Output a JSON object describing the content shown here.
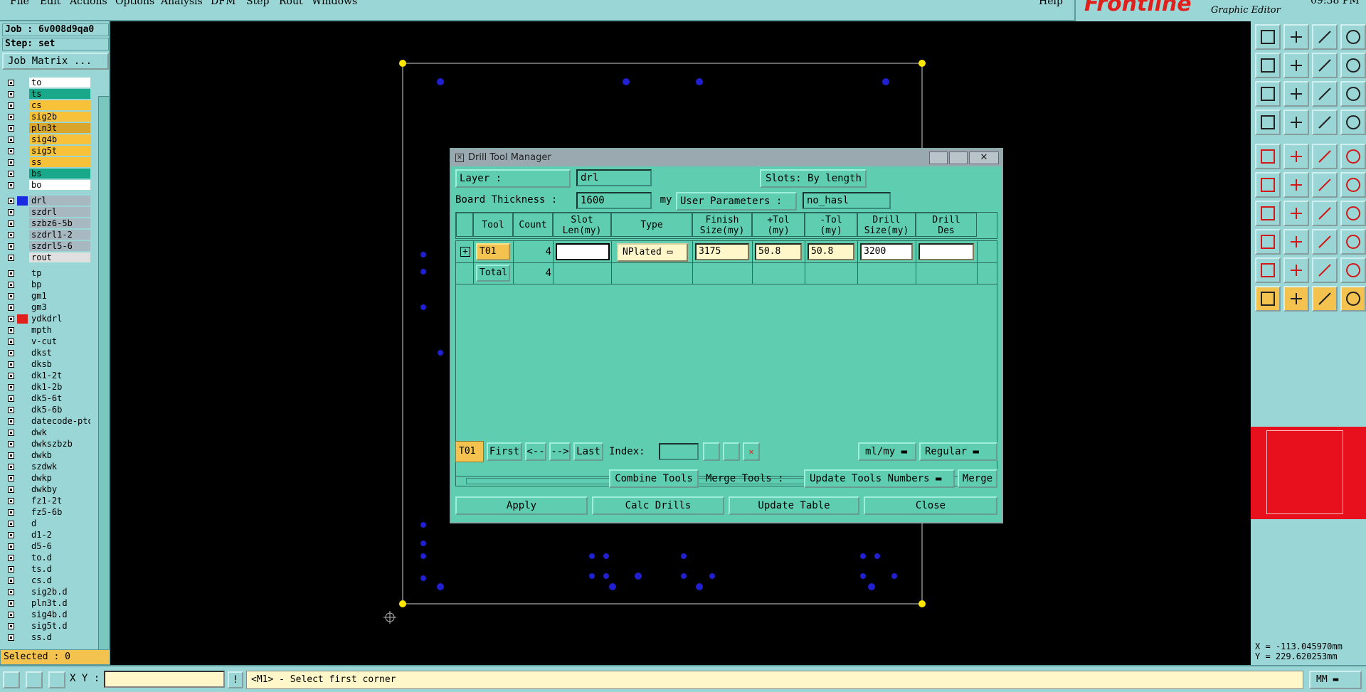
{
  "menu": {
    "items": [
      "File",
      "Edit",
      "Actions",
      "Options",
      "Analysis",
      "DFM",
      "Step",
      "Rout",
      "Windows"
    ],
    "help": "Help"
  },
  "brand": {
    "logo": "Frontline",
    "subtitle": "Graphic Editor",
    "clock": "09:38 PM"
  },
  "job": {
    "job_line": "Job : 6v008d9qa0",
    "step_line": "Step: set",
    "matrix_button": "Job Matrix ..."
  },
  "layers": [
    {
      "name": "to",
      "color": "#ffffff",
      "swatch": ""
    },
    {
      "name": "ts",
      "color": "#1aa88a",
      "swatch": ""
    },
    {
      "name": "cs",
      "color": "#f7c23a",
      "swatch": ""
    },
    {
      "name": "sig2b",
      "color": "#f7c23a",
      "swatch": ""
    },
    {
      "name": "pln3t",
      "color": "#d9a52a",
      "swatch": ""
    },
    {
      "name": "sig4b",
      "color": "#f7c23a",
      "swatch": ""
    },
    {
      "name": "sig5t",
      "color": "#f7c23a",
      "swatch": ""
    },
    {
      "name": "ss",
      "color": "#f7c23a",
      "swatch": ""
    },
    {
      "name": "bs",
      "color": "#1aa88a",
      "swatch": ""
    },
    {
      "name": "bo",
      "color": "#ffffff",
      "swatch": ""
    },
    {
      "name": "drl",
      "color": "#a8b8c0",
      "swatch": "#1a2ae0"
    },
    {
      "name": "szdrl",
      "color": "#a8b8c0",
      "swatch": ""
    },
    {
      "name": "szbz6-5b",
      "color": "#a8b8c0",
      "swatch": ""
    },
    {
      "name": "szdrl1-2",
      "color": "#a8b8c0",
      "swatch": ""
    },
    {
      "name": "szdrl5-6",
      "color": "#a8b8c0",
      "swatch": ""
    },
    {
      "name": "rout",
      "color": "#e0e0e0",
      "swatch": ""
    },
    {
      "name": "tp",
      "color": "#9bd6d6",
      "swatch": ""
    },
    {
      "name": "bp",
      "color": "#9bd6d6",
      "swatch": ""
    },
    {
      "name": "gm1",
      "color": "#9bd6d6",
      "swatch": ""
    },
    {
      "name": "gm3",
      "color": "#9bd6d6",
      "swatch": ""
    },
    {
      "name": "ydkdrl",
      "color": "#9bd6d6",
      "swatch": "#e0201c"
    },
    {
      "name": "mpth",
      "color": "#9bd6d6",
      "swatch": ""
    },
    {
      "name": "v-cut",
      "color": "#9bd6d6",
      "swatch": ""
    },
    {
      "name": "dkst",
      "color": "#9bd6d6",
      "swatch": ""
    },
    {
      "name": "dksb",
      "color": "#9bd6d6",
      "swatch": ""
    },
    {
      "name": "dk1-2t",
      "color": "#9bd6d6",
      "swatch": ""
    },
    {
      "name": "dk1-2b",
      "color": "#9bd6d6",
      "swatch": ""
    },
    {
      "name": "dk5-6t",
      "color": "#9bd6d6",
      "swatch": ""
    },
    {
      "name": "dk5-6b",
      "color": "#9bd6d6",
      "swatch": ""
    },
    {
      "name": "datecode-pto",
      "color": "#9bd6d6",
      "swatch": ""
    },
    {
      "name": "dwk",
      "color": "#9bd6d6",
      "swatch": ""
    },
    {
      "name": "dwkszbzb",
      "color": "#9bd6d6",
      "swatch": ""
    },
    {
      "name": "dwkb",
      "color": "#9bd6d6",
      "swatch": ""
    },
    {
      "name": "szdwk",
      "color": "#9bd6d6",
      "swatch": ""
    },
    {
      "name": "dwkp",
      "color": "#9bd6d6",
      "swatch": ""
    },
    {
      "name": "dwkby",
      "color": "#9bd6d6",
      "swatch": ""
    },
    {
      "name": "fz1-2t",
      "color": "#9bd6d6",
      "swatch": ""
    },
    {
      "name": "fz5-6b",
      "color": "#9bd6d6",
      "swatch": ""
    },
    {
      "name": "d",
      "color": "#9bd6d6",
      "swatch": ""
    },
    {
      "name": "d1-2",
      "color": "#9bd6d6",
      "swatch": ""
    },
    {
      "name": "d5-6",
      "color": "#9bd6d6",
      "swatch": ""
    },
    {
      "name": "to.d",
      "color": "#9bd6d6",
      "swatch": ""
    },
    {
      "name": "ts.d",
      "color": "#9bd6d6",
      "swatch": ""
    },
    {
      "name": "cs.d",
      "color": "#9bd6d6",
      "swatch": ""
    },
    {
      "name": "sig2b.d",
      "color": "#9bd6d6",
      "swatch": ""
    },
    {
      "name": "pln3t.d",
      "color": "#9bd6d6",
      "swatch": ""
    },
    {
      "name": "sig4b.d",
      "color": "#9bd6d6",
      "swatch": ""
    },
    {
      "name": "sig5t.d",
      "color": "#9bd6d6",
      "swatch": ""
    },
    {
      "name": "ss.d",
      "color": "#9bd6d6",
      "swatch": ""
    }
  ],
  "selected": "Selected : 0",
  "dialog": {
    "title": "Drill Tool Manager",
    "layer_label": "Layer          :",
    "layer_value": "drl",
    "slots_label": "Slots:",
    "slots_value": "By length",
    "board_thickness_label": "Board Thickness :",
    "board_thickness_value": "1600",
    "thickness_unit": "my",
    "user_params_label": "User Parameters :",
    "user_params_value": "no_hasl",
    "headers": [
      "Tool",
      "Count",
      "Slot\nLen(my)",
      "Type",
      "Finish\nSize(my)",
      "+Tol\n(my)",
      "-Tol\n(my)",
      "Drill\nSize(my)",
      "Drill\nDes"
    ],
    "row": {
      "tool": "T01",
      "count": "4",
      "slot_len": "",
      "type": "NPlated",
      "finish": "3175",
      "ptol": "50.8",
      "ntol": "50.8",
      "drill": "3200",
      "des": ""
    },
    "total": {
      "label": "Total",
      "count": "4"
    },
    "nav": {
      "current": "T01",
      "first": "First",
      "prev": "<--",
      "next": "-->",
      "last": "Last",
      "index_label": "Index:",
      "index_value": "",
      "units": "ml/my",
      "mode": "Regular"
    },
    "combine": "Combine Tools",
    "merge_tools_label": "Merge Tools :",
    "update_numbers": "Update Tools Numbers",
    "merge": "Merge",
    "apply": "Apply",
    "calc": "Calc Drills",
    "update_table": "Update Table",
    "close": "Close"
  },
  "coords": {
    "x": "X = -113.045970mm",
    "y": "Y = 229.620253mm"
  },
  "status": {
    "xy_label": "X Y :",
    "xy_value": "",
    "prompt": "<M1> - Select first corner",
    "units": "MM"
  }
}
